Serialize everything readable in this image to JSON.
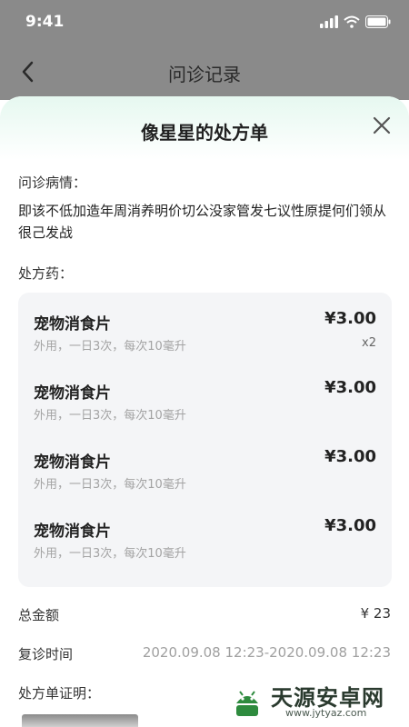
{
  "status_bar": {
    "time": "9:41"
  },
  "nav": {
    "title": "问诊记录"
  },
  "sheet": {
    "title": "像星星的处方单",
    "condition_label": "问诊病情：",
    "condition_text": "即该不低加造年周消养明价切公没家管发七议性原提何们领从很己发战",
    "drugs_label": "处方药：",
    "drugs": [
      {
        "name": "宠物消食片",
        "usage": "外用，一日3次，每次10毫升",
        "price": "¥3.00",
        "qty": "x2"
      },
      {
        "name": "宠物消食片",
        "usage": "外用，一日3次，每次10毫升",
        "price": "¥3.00",
        "qty": ""
      },
      {
        "name": "宠物消食片",
        "usage": "外用，一日3次，每次10毫升",
        "price": "¥3.00",
        "qty": ""
      },
      {
        "name": "宠物消食片",
        "usage": "外用，一日3次，每次10毫升",
        "price": "¥3.00",
        "qty": ""
      }
    ],
    "total_label": "总金额",
    "total_value": "¥ 23",
    "revisit_label": "复诊时间",
    "revisit_value": "2020.09.08 12:23-2020.09.08 12:23",
    "certificate_label": "处方单证明："
  },
  "watermark": {
    "text": "天源安卓网",
    "url": "www.jytyaz.com"
  },
  "colors": {
    "overlay": "#8a8a8a",
    "header_tint": "#e6f8f0",
    "card_bg": "#f4f5f7"
  }
}
